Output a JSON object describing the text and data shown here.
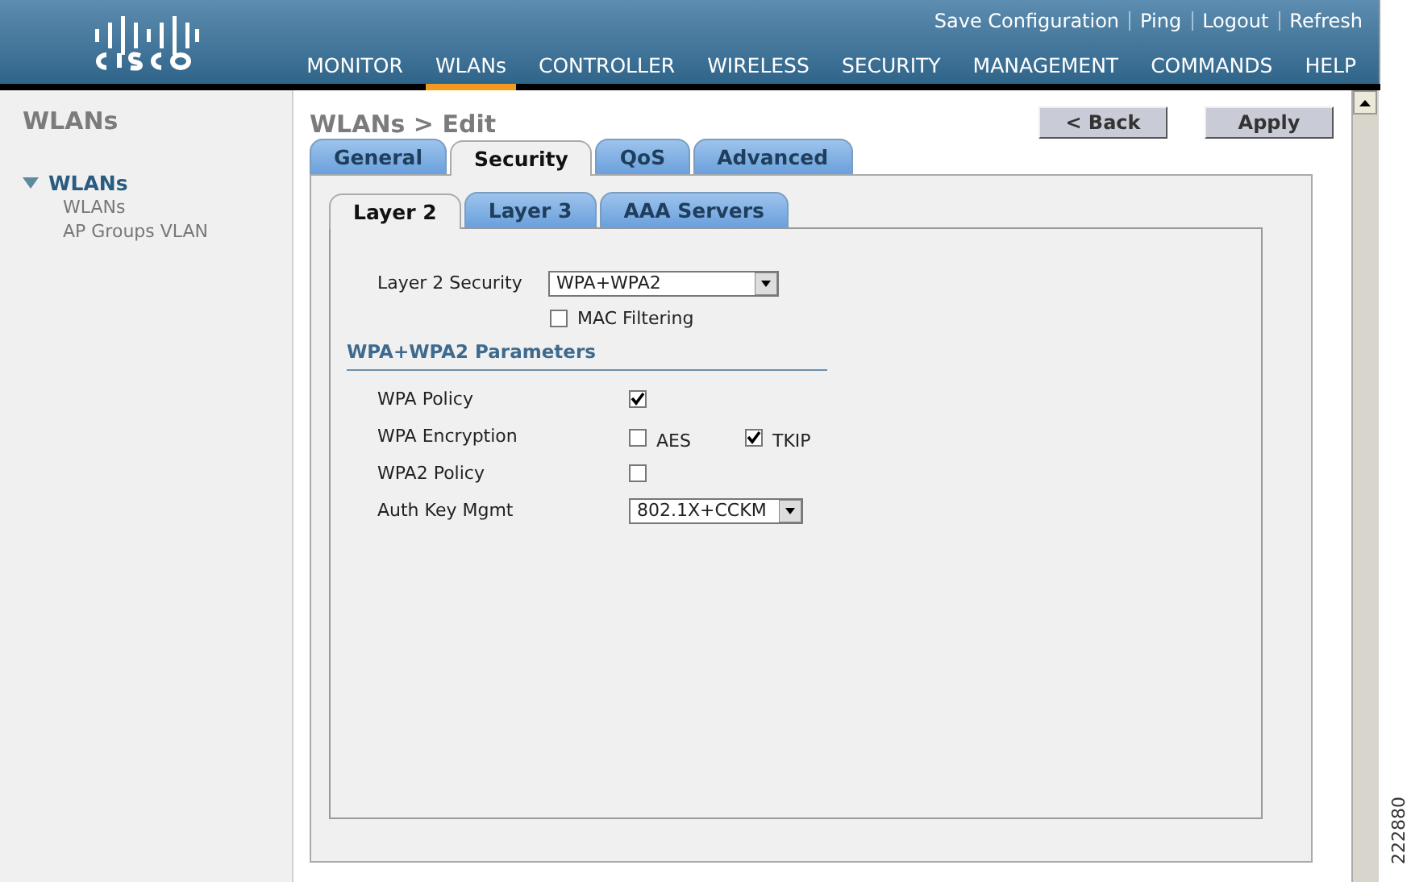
{
  "header": {
    "top_links": [
      "Save Configuration",
      "Ping",
      "Logout",
      "Refresh"
    ],
    "menu": [
      {
        "label": "MONITOR",
        "selected": false
      },
      {
        "label": "WLANs",
        "selected": true
      },
      {
        "label": "CONTROLLER",
        "selected": false
      },
      {
        "label": "WIRELESS",
        "selected": false
      },
      {
        "label": "SECURITY",
        "selected": false
      },
      {
        "label": "MANAGEMENT",
        "selected": false
      },
      {
        "label": "COMMANDS",
        "selected": false
      },
      {
        "label": "HELP",
        "selected": false
      }
    ]
  },
  "sidebar": {
    "title": "WLANs",
    "section": {
      "label": "WLANs",
      "expanded": true,
      "children": [
        "WLANs",
        "AP Groups VLAN"
      ]
    }
  },
  "page_title": "WLANs > Edit",
  "buttons": [
    "< Back",
    "Apply"
  ],
  "tabs": [
    {
      "label": "General",
      "selected": false
    },
    {
      "label": "Security",
      "selected": true
    },
    {
      "label": "QoS",
      "selected": false
    },
    {
      "label": "Advanced",
      "selected": false
    }
  ],
  "subtabs": [
    {
      "label": "Layer 2",
      "selected": true
    },
    {
      "label": "Layer 3",
      "selected": false
    },
    {
      "label": "AAA Servers",
      "selected": false
    }
  ],
  "layer2_security": {
    "label": "Layer 2 Security",
    "value": "WPA+WPA2"
  },
  "mac_filtering": {
    "label": "MAC Filtering",
    "checked": false
  },
  "section_title": "WPA+WPA2 Parameters",
  "params": [
    {
      "kind": "checkboxes",
      "label": "WPA Policy",
      "options": [
        {
          "checked": true
        }
      ]
    },
    {
      "kind": "checkboxes",
      "label": "WPA Encryption",
      "options": [
        {
          "label": "AES",
          "checked": false
        },
        {
          "label": "TKIP",
          "checked": true
        }
      ]
    },
    {
      "kind": "checkboxes",
      "label": "WPA2 Policy",
      "options": [
        {
          "checked": false
        }
      ]
    },
    {
      "kind": "select",
      "label": "Auth Key Mgmt",
      "value": "802.1X+CCKM"
    }
  ],
  "figure_number": "222880"
}
